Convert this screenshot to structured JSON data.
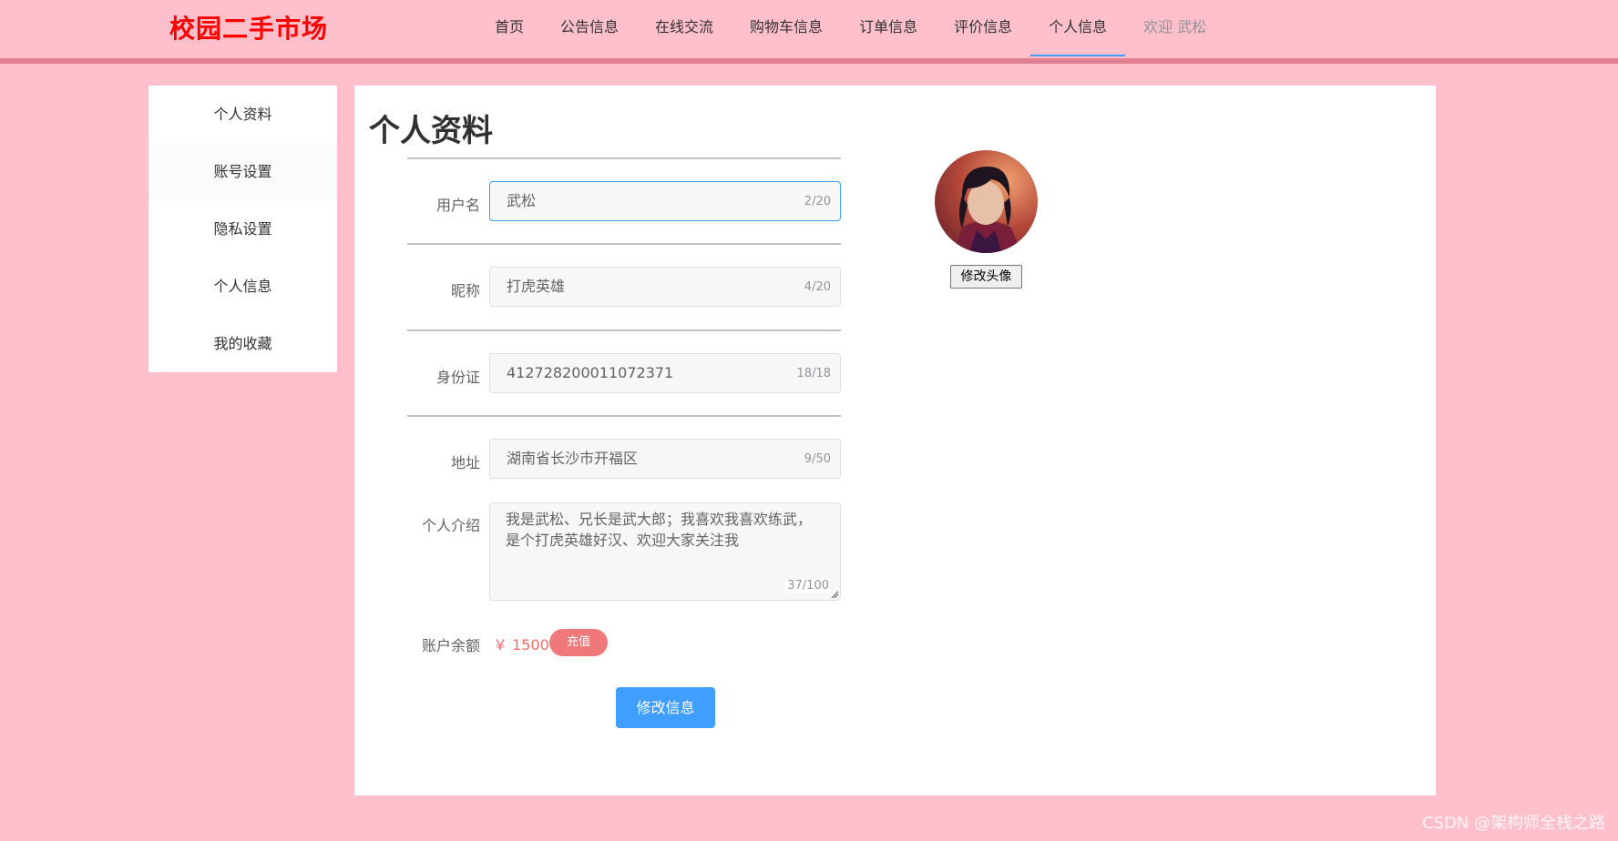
{
  "brand": "校园二手市场",
  "nav": {
    "items": [
      "首页",
      "公告信息",
      "在线交流",
      "购物车信息",
      "订单信息",
      "评价信息",
      "个人信息"
    ],
    "active_index": 6,
    "welcome": "欢迎 武松"
  },
  "sidebar": {
    "items": [
      "个人资料",
      "账号设置",
      "隐私设置",
      "个人信息",
      "我的收藏"
    ]
  },
  "profile": {
    "title": "个人资料",
    "username": {
      "label": "用户名",
      "value": "武松",
      "count": "2/20"
    },
    "nickname": {
      "label": "昵称",
      "value": "打虎英雄",
      "count": "4/20"
    },
    "id_card": {
      "label": "身份证",
      "value": "412728200011072371",
      "count": "18/18"
    },
    "address": {
      "label": "地址",
      "value": "湖南省长沙市开福区",
      "count": "9/50"
    },
    "intro": {
      "label": "个人介绍",
      "value": "我是武松、兄长是武大郎；我喜欢我喜欢练武，是个打虎英雄好汉、欢迎大家关注我",
      "count": "37/100"
    },
    "balance": {
      "label": "账户余额",
      "value": "￥ 1500",
      "recharge_label": "充值"
    },
    "submit_label": "修改信息",
    "change_avatar_label": "修改头像"
  },
  "watermark": "CSDN @架构师全栈之路",
  "colors": {
    "background": "#ffc0cb",
    "brand": "#ff0000",
    "primary": "#409eff",
    "danger": "#f56c6c"
  }
}
